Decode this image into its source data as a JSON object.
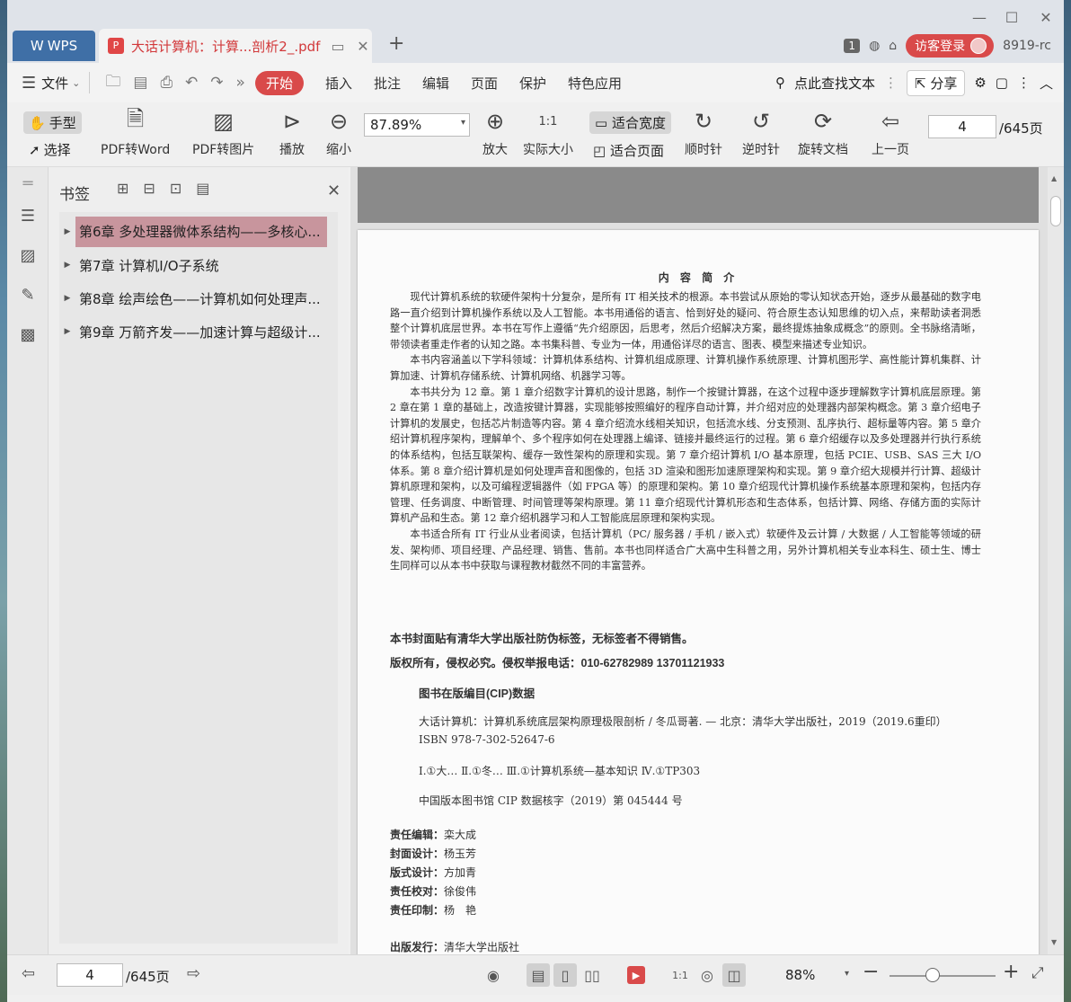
{
  "titlebar": {
    "app_tab": "WPS",
    "doc_tab": "大话计算机：计算...剖析2_.pdf",
    "page_badge": "1",
    "login_label": "访客登录",
    "user_id": "8919-rc"
  },
  "menubar": {
    "file_label": "文件",
    "tabs": [
      "开始",
      "插入",
      "批注",
      "编辑",
      "页面",
      "保护",
      "特色应用"
    ],
    "search_label": "点此查找文本",
    "share_label": "分享"
  },
  "toolbar": {
    "hand_label": "手型",
    "select_label": "选择",
    "pdf_to_word": "PDF转Word",
    "pdf_to_image": "PDF转图片",
    "play": "播放",
    "zoom_out": "缩小",
    "zoom_value": "87.89%",
    "zoom_in": "放大",
    "actual_size": "实际大小",
    "fit_width": "适合宽度",
    "fit_page": "适合页面",
    "clockwise": "顺时针",
    "counterclockwise": "逆时针",
    "rotate_doc": "旋转文档",
    "prev_page": "上一页",
    "page_value": "4",
    "page_total": "/645页"
  },
  "bookmarks": {
    "title": "书签",
    "items": [
      "第6章  多处理器微体系结构——多核心...",
      "第7章  计算机I/O子系统",
      "第8章  绘声绘色——计算机如何处理声...",
      "第9章  万箭齐发——加速计算与超级计..."
    ]
  },
  "document": {
    "heading": "内 容 简 介",
    "paragraphs": [
      "现代计算机系统的软硬件架构十分复杂，是所有 IT 相关技术的根源。本书尝试从原始的零认知状态开始，逐步从最基础的数字电路一直介绍到计算机操作系统以及人工智能。本书用通俗的语言、恰到好处的疑问、符合原生态认知思维的切入点，来帮助读者洞悉整个计算机底层世界。本书在写作上遵循“先介绍原因，后思考，然后介绍解决方案，最终提炼抽象成概念”的原则。全书脉络清晰，带领读者重走作者的认知之路。本书集科普、专业为一体，用通俗详尽的语言、图表、模型来描述专业知识。",
      "本书内容涵盖以下学科领域：计算机体系结构、计算机组成原理、计算机操作系统原理、计算机图形学、高性能计算机集群、计算加速、计算机存储系统、计算机网络、机器学习等。",
      "本书共分为 12 章。第 1 章介绍数字计算机的设计思路，制作一个按键计算器，在这个过程中逐步理解数字计算机底层原理。第 2 章在第 1 章的基础上，改造按键计算器，实现能够按照编好的程序自动计算，并介绍对应的处理器内部架构概念。第 3 章介绍电子计算机的发展史，包括芯片制造等内容。第 4 章介绍流水线相关知识，包括流水线、分支预测、乱序执行、超标量等内容。第 5 章介绍计算机程序架构，理解单个、多个程序如何在处理器上编译、链接并最终运行的过程。第 6 章介绍缓存以及多处理器并行执行系统的体系结构，包括互联架构、缓存一致性架构的原理和实现。第 7 章介绍计算机 I/O 基本原理，包括 PCIE、USB、SAS 三大 I/O 体系。第 8 章介绍计算机是如何处理声音和图像的，包括 3D 渲染和图形加速原理架构和实现。第 9 章介绍大规模并行计算、超级计算机原理和架构，以及可编程逻辑器件（如 FPGA 等）的原理和架构。第 10 章介绍现代计算机操作系统基本原理和架构，包括内存管理、任务调度、中断管理、时间管理等架构原理。第 11 章介绍现代计算机形态和生态体系，包括计算、网络、存储方面的实际计算机产品和生态。第 12 章介绍机器学习和人工智能底层原理和架构实现。",
      "本书适合所有 IT 行业从业者阅读，包括计算机（PC/ 服务器 / 手机 / 嵌入式）软硬件及云计算 / 大数据 / 人工智能等领域的研发、架构师、项目经理、产品经理、销售、售前。本书也同样适合广大高中生科普之用，另外计算机相关专业本科生、硕士生、博士生同样可以从本书中获取与课程教材截然不同的丰富营养。"
    ],
    "notice1": "本书封面贴有清华大学出版社防伪标签，无标签者不得销售。",
    "notice2": "版权所有，侵权必究。侵权举报电话：010-62782989  13701121933",
    "cip_title": "图书在版编目(CIP)数据",
    "cip_line1": "大话计算机：计算机系统底层架构原理极限剖析 / 冬瓜哥著. — 北京：清华大学出版社，2019（2019.6重印）",
    "cip_line2": "ISBN 978-7-302-52647-6",
    "cip_line3": "Ⅰ.①大…   Ⅱ.①冬…   Ⅲ.①计算机系统—基本知识   Ⅳ.①TP303",
    "cip_line4": "中国版本图书馆 CIP 数据核字（2019）第 045444 号",
    "credits": [
      {
        "role": "责任编辑：",
        "name": "栾大成"
      },
      {
        "role": "封面设计：",
        "name": "杨玉芳"
      },
      {
        "role": "版式设计：",
        "name": "方加青"
      },
      {
        "role": "责任校对：",
        "name": "徐俊伟"
      },
      {
        "role": "责任印制：",
        "name": "杨　艳"
      },
      {
        "role": "出版发行：",
        "name": "清华大学出版社"
      }
    ]
  },
  "statusbar": {
    "page_value": "4",
    "page_total": "/645页",
    "zoom_value": "88%"
  },
  "colors": {
    "accent": "#d94a4a",
    "wps_blue": "#3f6fa6",
    "bookmark_highlight": "#c8959d"
  }
}
